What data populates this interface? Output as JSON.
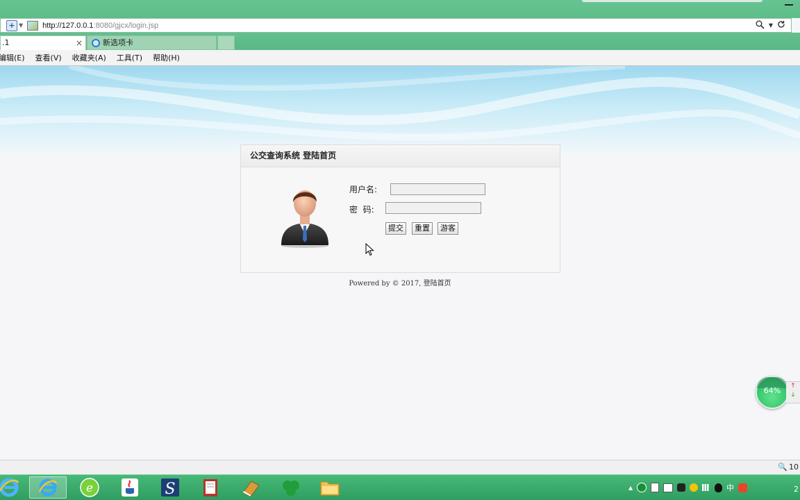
{
  "browser": {
    "url_host": "http://127.0.0.1",
    "url_rest": ":8080/gjcx/login.jsp",
    "search_icon": "search-icon",
    "refresh_icon": "refresh-icon",
    "tabs": [
      {
        "label": ".1",
        "active": true
      },
      {
        "label": "新选项卡",
        "active": false
      }
    ],
    "tab_close": "×",
    "menu": [
      "编辑(E)",
      "查看(V)",
      "收藏夹(A)",
      "工具(T)",
      "帮助(H)"
    ],
    "zoom": "10"
  },
  "login": {
    "title": "公交查询系统 登陆首页",
    "username_label": "用户名:",
    "password_label": "密  码:",
    "username_value": "",
    "password_value": "",
    "submit_label": "提交",
    "reset_label": "重置",
    "guest_label": "游客",
    "footer": "Powered by © 2017, 登陆首页"
  },
  "widget": {
    "percent": "64%",
    "up": "↑",
    "down": "↓"
  },
  "taskbar": {
    "apps": [
      "ie-icon",
      "browser-icon",
      "java-icon",
      "s-app-icon",
      "notebook-icon",
      "book-icon",
      "green-app-icon",
      "folder-icon"
    ],
    "tray_caret": "▲",
    "tray_ime": "中",
    "clock_partial": "2"
  },
  "colors": {
    "taskbar": "#2f9d61",
    "frame": "#5dbd88",
    "widget": "#35c76b"
  }
}
